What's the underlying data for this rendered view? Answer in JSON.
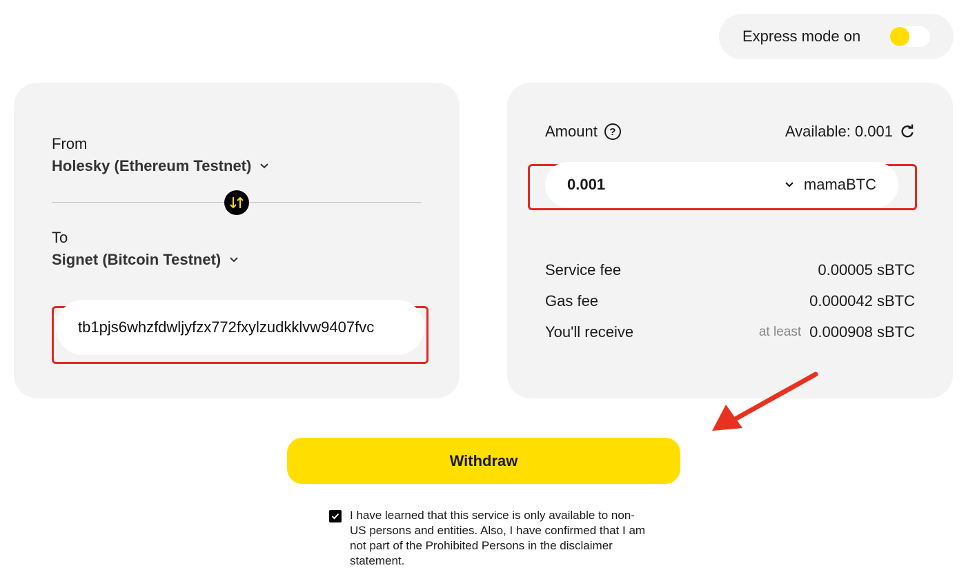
{
  "express": {
    "label": "Express mode on",
    "enabled": true
  },
  "from": {
    "label": "From",
    "network": "Holesky (Ethereum Testnet)"
  },
  "to": {
    "label": "To",
    "network": "Signet (Bitcoin Testnet)"
  },
  "address": {
    "value": "tb1pjs6whzfdwljyfzx772fxylzudkklvw9407fvc"
  },
  "amount": {
    "label": "Amount",
    "available": "Available: 0.001",
    "value": "0.001",
    "token": "mamaBTC"
  },
  "fees": {
    "service_label": "Service fee",
    "service_value": "0.00005 sBTC",
    "gas_label": "Gas fee",
    "gas_value": "0.000042 sBTC",
    "receive_label": "You'll receive",
    "receive_qualifier": "at least",
    "receive_value": "0.000908 sBTC"
  },
  "withdraw_label": "Withdraw",
  "disclaimer": {
    "checked": true,
    "text": "I have learned that this service is only available to non-US persons and entities. Also, I have confirmed that I am not part of the Prohibited Persons in the disclaimer statement."
  },
  "colors": {
    "accent": "#ffde00",
    "highlight": "#e02a20",
    "card": "#f3f3f3"
  },
  "icons": [
    "swap-icon",
    "chevron-down-icon",
    "help-icon",
    "refresh-icon",
    "check-icon"
  ]
}
